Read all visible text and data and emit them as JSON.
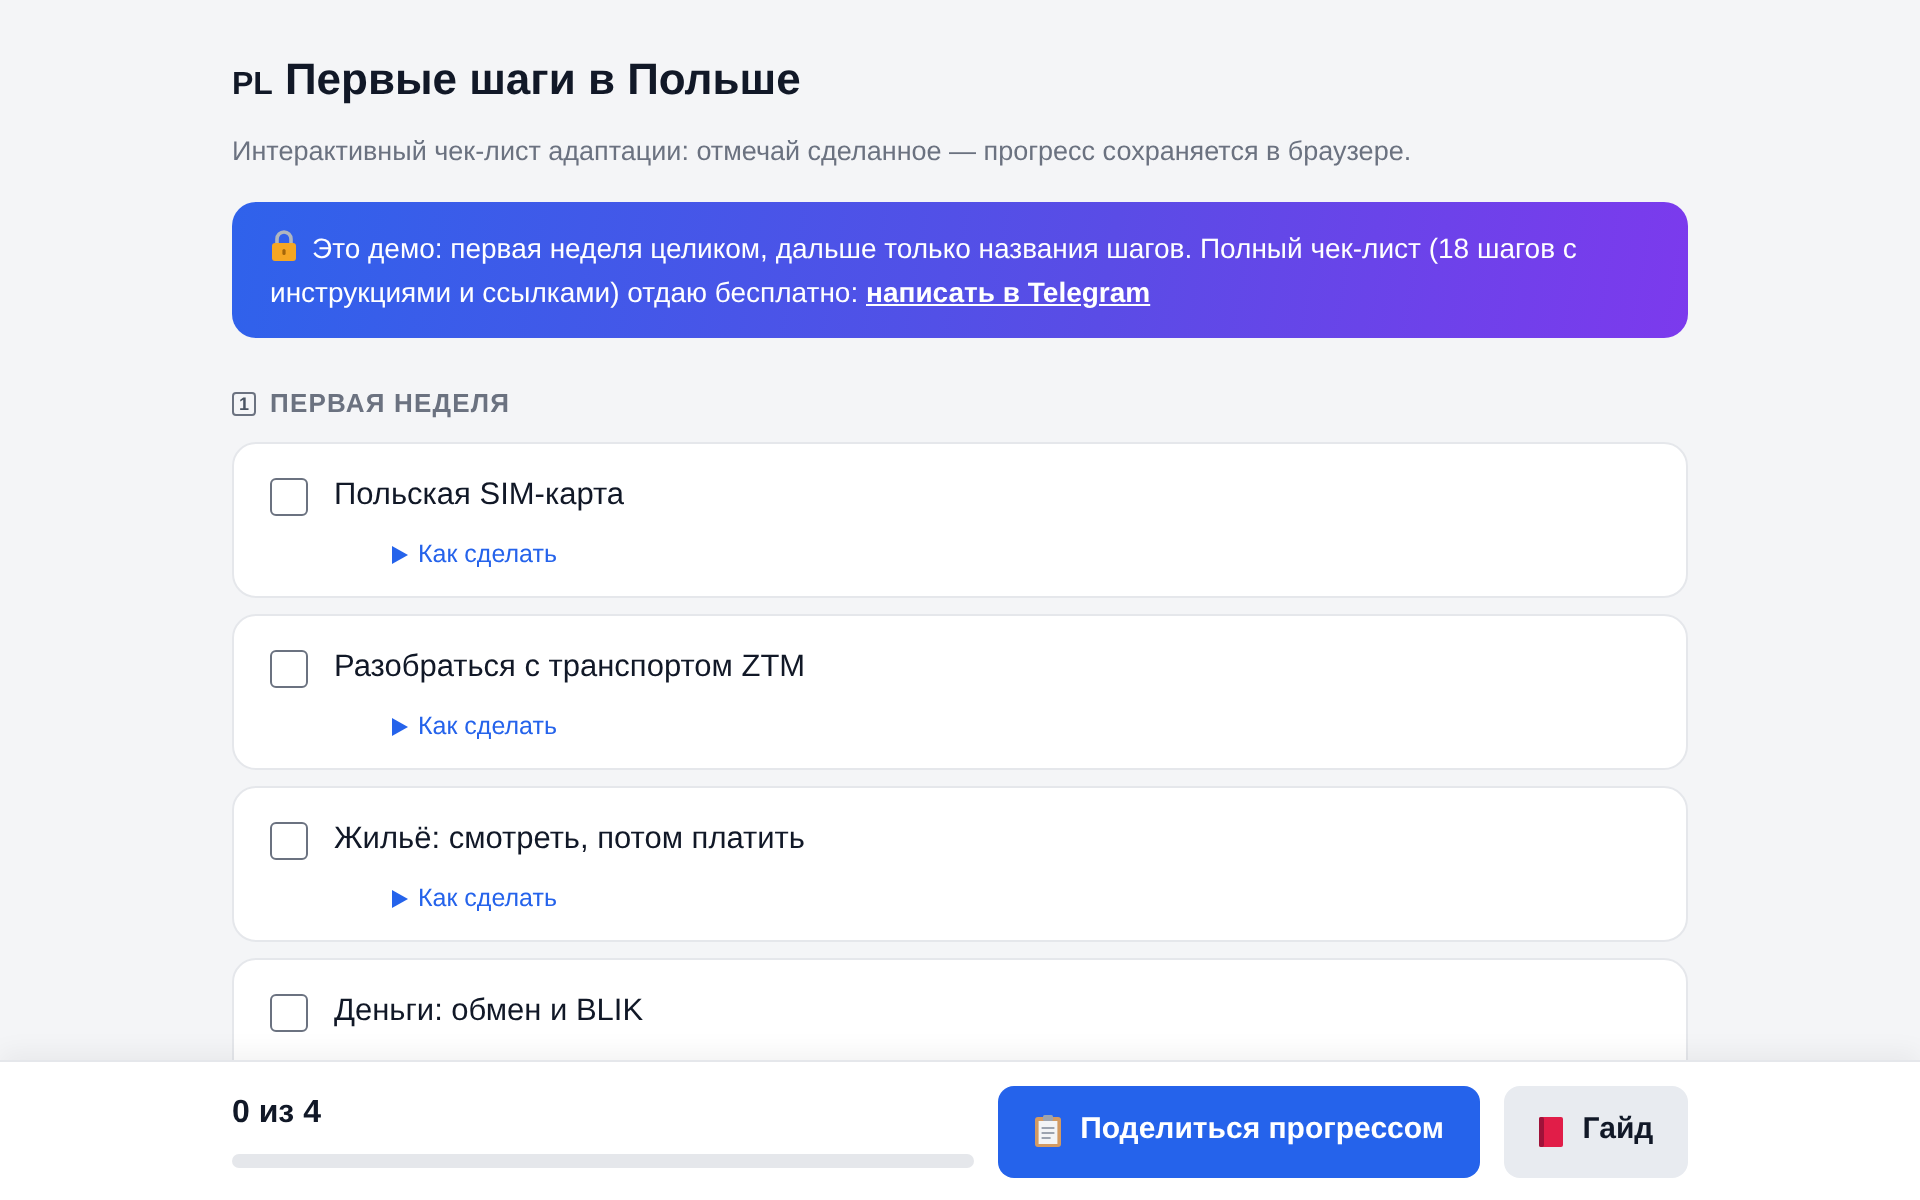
{
  "header": {
    "flag": "PL",
    "title": "Первые шаги в Польше",
    "subtitle": "Интерактивный чек-лист адаптации: отмечай сделанное — прогресс сохраняется в браузере."
  },
  "notice": {
    "text": "Это демо: первая неделя целиком, дальше только названия шагов. Полный чек-лист (18 шагов с инструкциями и ссылками) отдаю бесплатно: ",
    "link": "написать в Telegram"
  },
  "section": {
    "number": "1",
    "title": "ПЕРВАЯ НЕДЕЛЯ"
  },
  "steps": [
    {
      "title": "Польская SIM-карта",
      "checked": false,
      "details_label": "Как сделать"
    },
    {
      "title": "Разобраться с транспортом ZTM",
      "checked": false,
      "details_label": "Как сделать"
    },
    {
      "title": "Жильё: смотреть, потом платить",
      "checked": false,
      "details_label": "Как сделать"
    },
    {
      "title": "Деньги: обмен и BLIK",
      "checked": false
    }
  ],
  "footer": {
    "counter": "0 из 4",
    "level": 0,
    "buttons": [
      {
        "kind": "primary",
        "label": "Поделиться прогрессом"
      },
      {
        "kind": "secondary",
        "label": "Гайд"
      }
    ]
  }
}
